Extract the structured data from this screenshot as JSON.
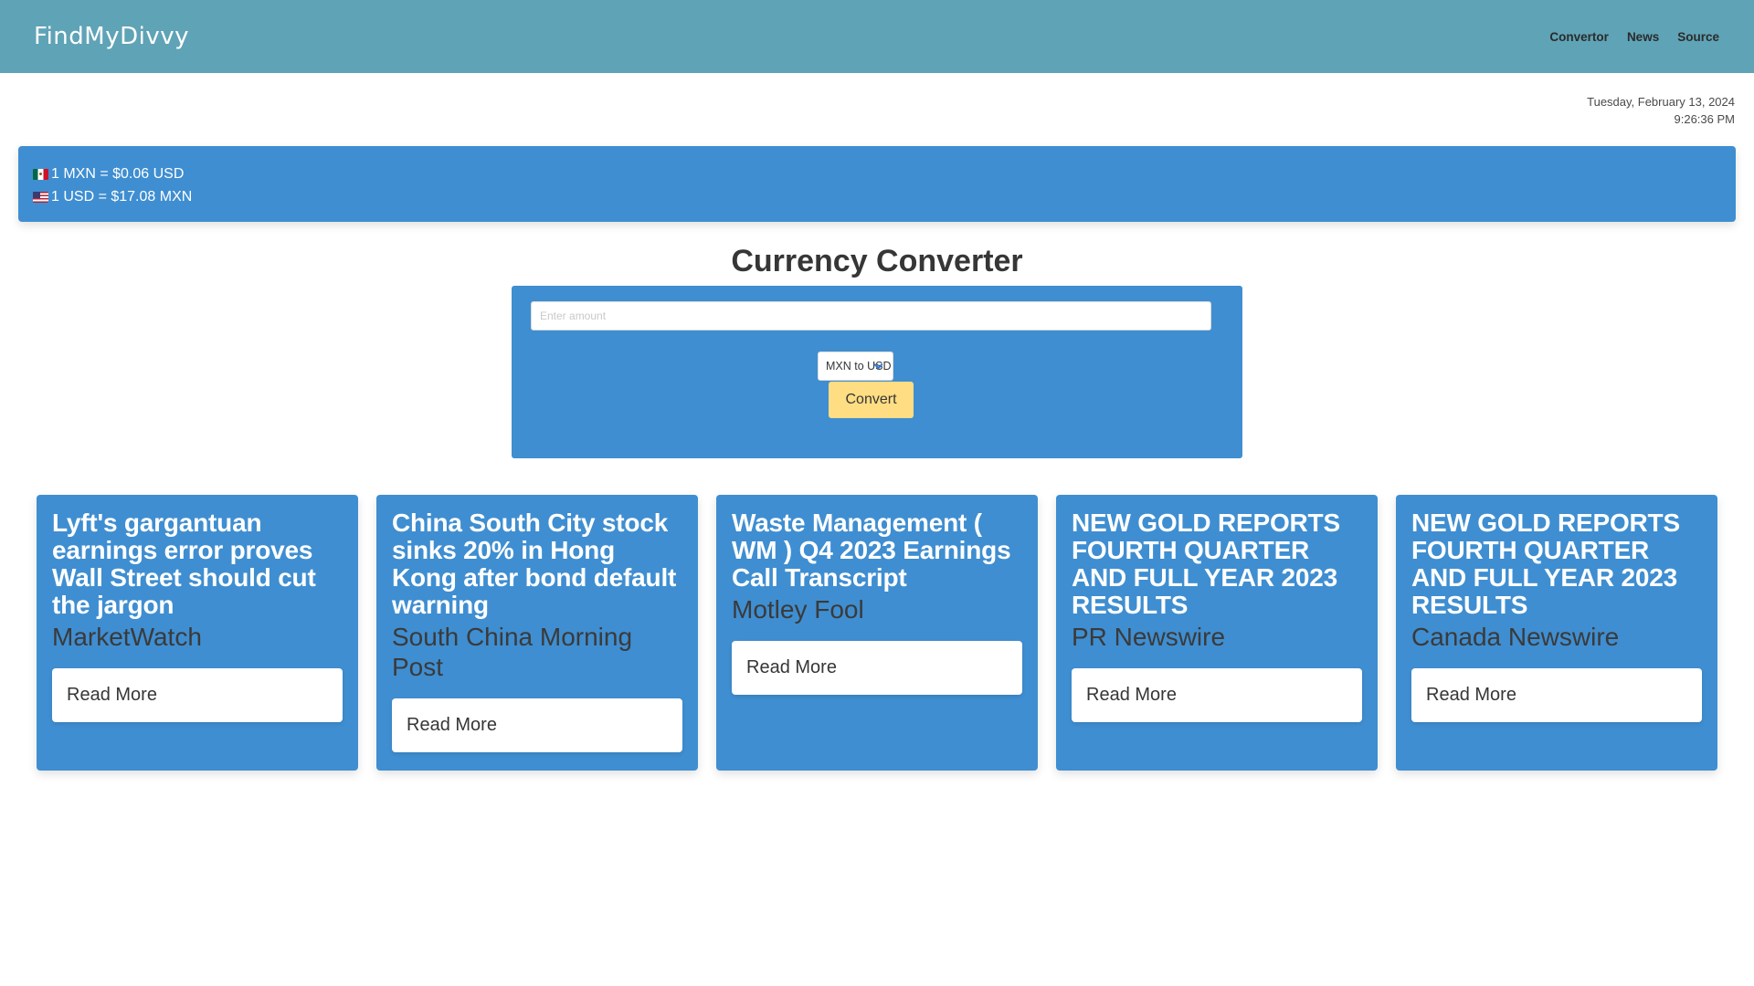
{
  "navbar": {
    "brand": "FindMyDivvy",
    "links": [
      "Convertor",
      "News",
      "Source"
    ]
  },
  "datetime": {
    "date": "Tuesday, February 13, 2024",
    "time": "9:26:36 PM"
  },
  "rates": {
    "mxn_to_usd": "1 MXN = $0.06 USD",
    "usd_to_mxn": "1 USD = $17.08 MXN",
    "flags": [
      "mexico-flag-icon",
      "us-flag-icon"
    ]
  },
  "converter": {
    "title": "Currency Converter",
    "amount_placeholder": "Enter amount",
    "amount_value": "",
    "direction_selected": "MXN to USD",
    "convert_label": "Convert"
  },
  "news": [
    {
      "title": "Lyft's gargantuan earnings error proves Wall Street should cut the jargon",
      "source": "MarketWatch",
      "cta": "Read More"
    },
    {
      "title": "China South City stock sinks 20% in Hong Kong after bond default warning",
      "source": "South China Morning Post",
      "cta": "Read More"
    },
    {
      "title": "Waste Management ( WM ) Q4 2023 Earnings Call Transcript",
      "source": "Motley Fool",
      "cta": "Read More"
    },
    {
      "title": "NEW GOLD REPORTS FOURTH QUARTER AND FULL YEAR 2023 RESULTS",
      "source": "PR Newswire",
      "cta": "Read More"
    },
    {
      "title": "NEW GOLD REPORTS FOURTH QUARTER AND FULL YEAR 2023 RESULTS",
      "source": "Canada Newswire",
      "cta": "Read More"
    }
  ],
  "colors": {
    "navbar": "#5fa3b6",
    "panel": "#3f8ed1",
    "button": "#ffdd83"
  }
}
